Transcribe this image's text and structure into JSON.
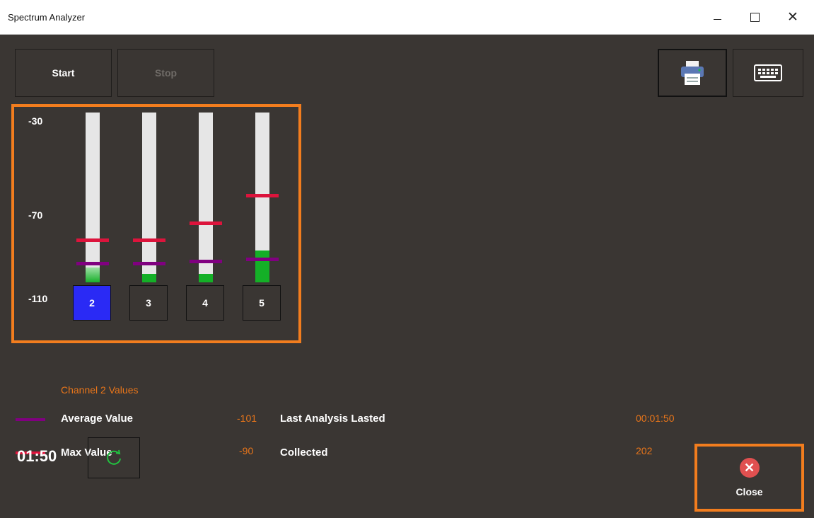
{
  "window": {
    "title": "Spectrum Analyzer"
  },
  "toolbar": {
    "start_label": "Start",
    "stop_label": "Stop",
    "print_icon": "printer-icon",
    "keyboard_icon": "keyboard-icon"
  },
  "meter": {
    "y_labels": [
      "-30",
      "-70",
      "-110"
    ],
    "y_range": [
      -110,
      -30
    ],
    "channels": [
      {
        "label": "2",
        "level": -103,
        "average": -101,
        "max": -90,
        "selected": true
      },
      {
        "label": "3",
        "level": -106,
        "average": -101,
        "max": -90,
        "selected": false
      },
      {
        "label": "4",
        "level": -106,
        "average": -100,
        "max": -82,
        "selected": false
      },
      {
        "label": "5",
        "level": -95,
        "average": -99,
        "max": -69,
        "selected": false
      }
    ],
    "colors": {
      "max_marker": "#dc143c",
      "average_marker": "#800080",
      "level_fill": "#14b027",
      "selected_channel": "#2a2af5"
    }
  },
  "stats": {
    "heading": "Channel 2 Values",
    "average_label": "Average Value",
    "average_value": "-101",
    "max_label": "Max Value",
    "max_value": "-90",
    "last_analysis_label": "Last Analysis Lasted",
    "last_analysis_value": "00:01:50",
    "collected_label": "Collected",
    "collected_value": "202"
  },
  "footer": {
    "timer": "01:50",
    "refresh_icon": "refresh-icon",
    "close_label": "Close",
    "close_icon": "close-circle-icon"
  }
}
